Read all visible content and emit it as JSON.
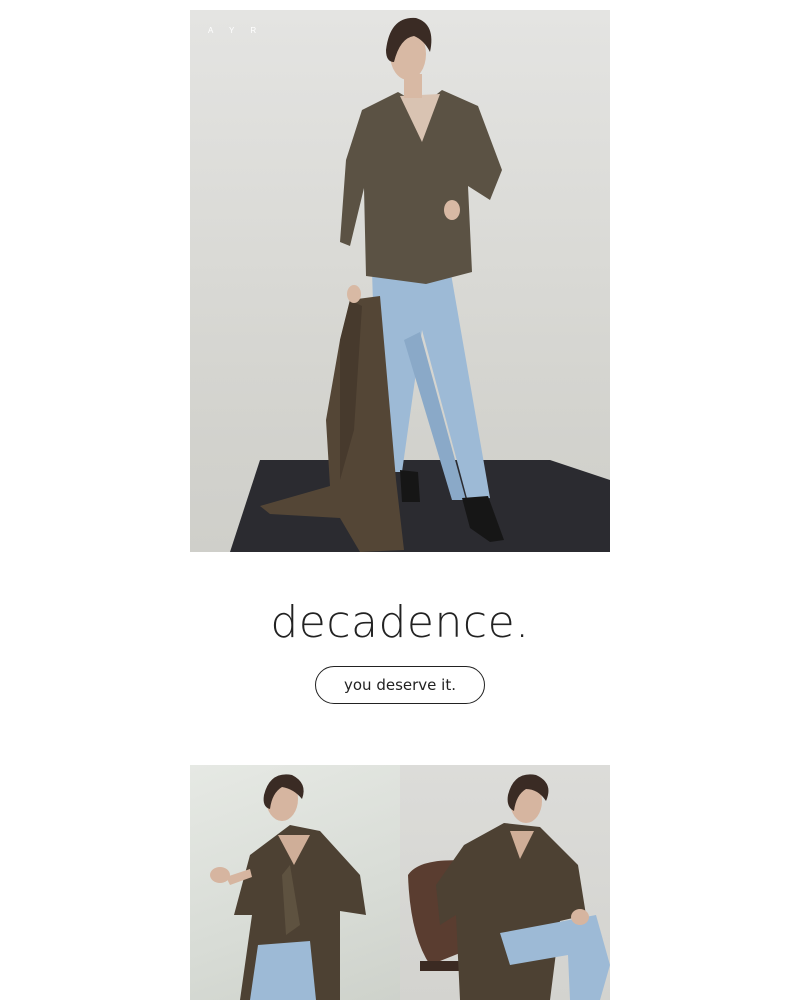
{
  "brand": {
    "logo_text": "A Y R"
  },
  "hero": {
    "image_description_icon": "model-in-sweater-and-jeans-photo"
  },
  "headline": {
    "title": "decadence.",
    "cta_label": "you deserve it."
  },
  "gallery": {
    "left_icon": "model-in-long-coat-photo",
    "right_icon": "model-seated-in-chair-photo"
  },
  "colors": {
    "sweater": "#5b5244",
    "denim": "#9dbad6",
    "platform": "#2b2b30",
    "text": "#222222"
  }
}
